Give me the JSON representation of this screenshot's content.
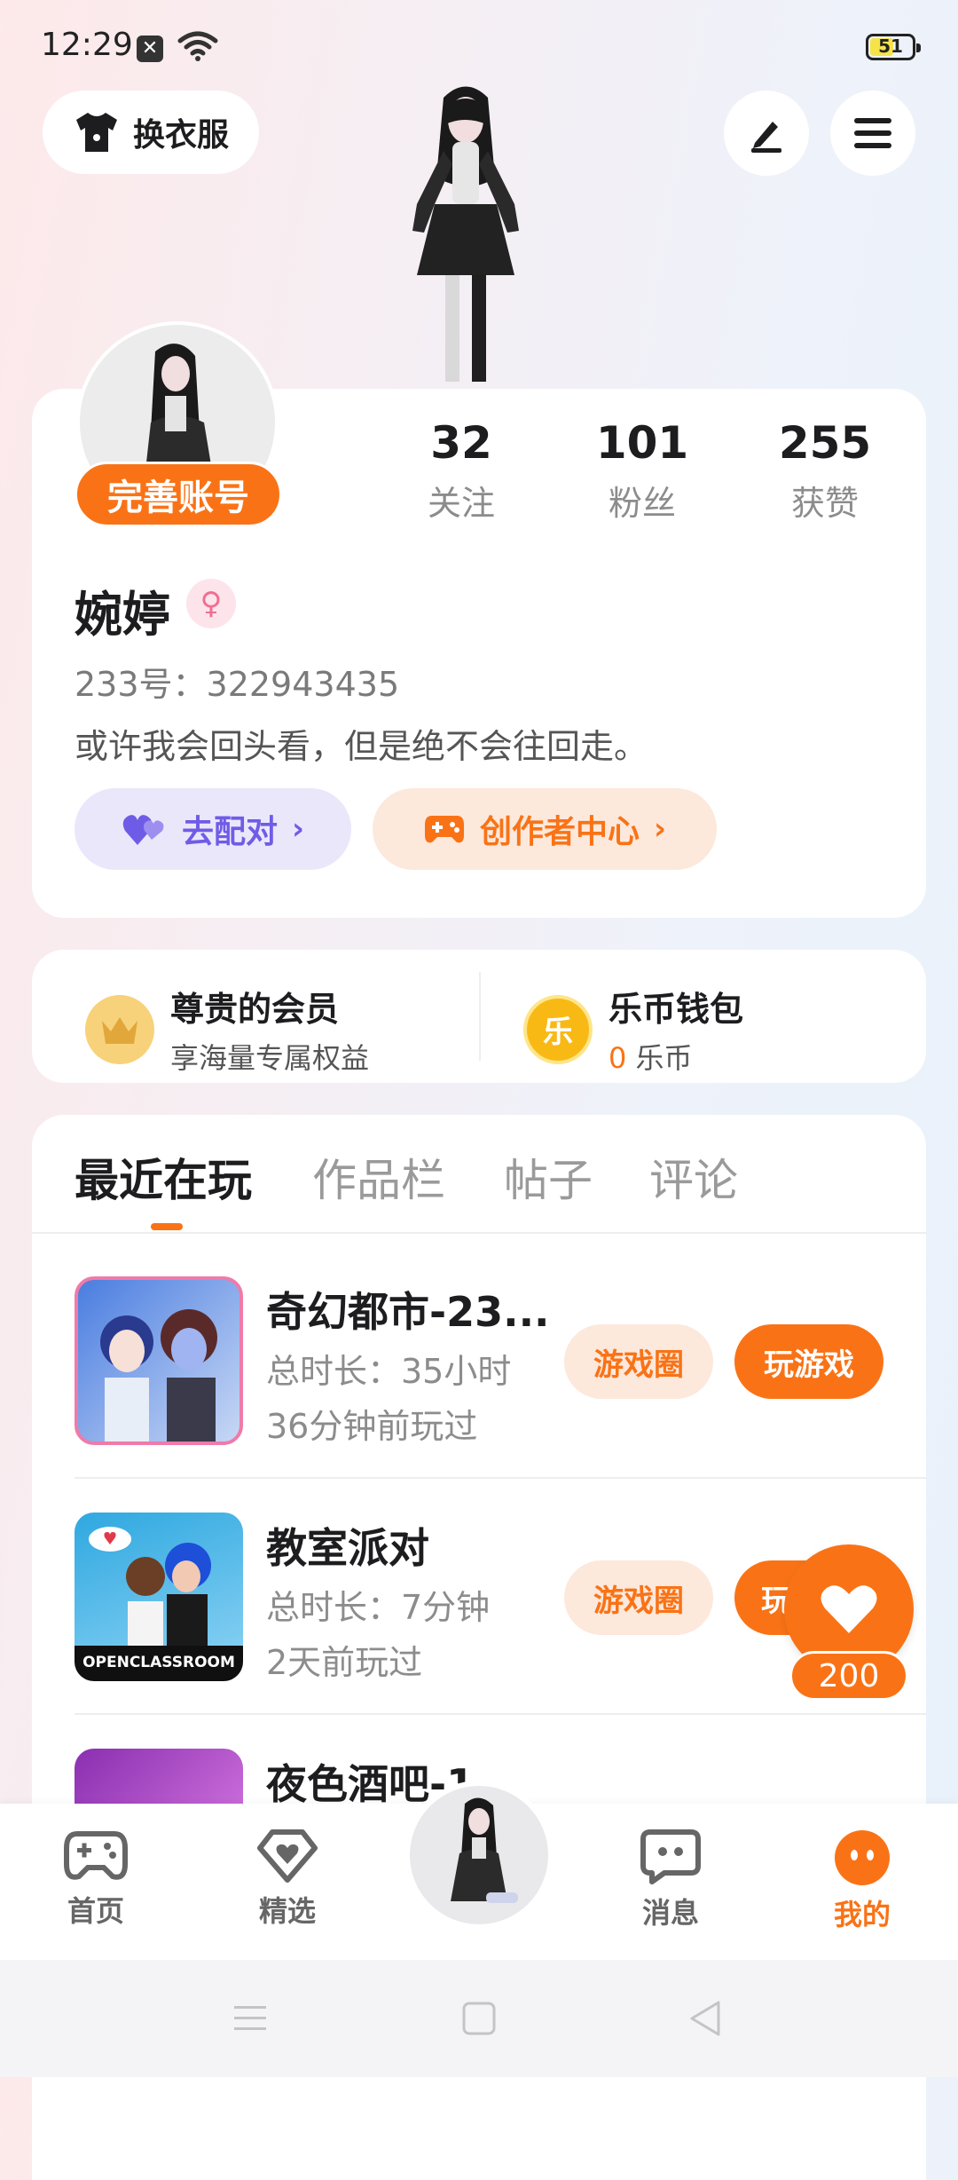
{
  "status_bar": {
    "time": "12:29",
    "battery": "51"
  },
  "top": {
    "outfit_label": "换衣服"
  },
  "profile": {
    "complete_label": "完善账号",
    "stats": [
      {
        "num": "32",
        "label": "关注"
      },
      {
        "num": "101",
        "label": "粉丝"
      },
      {
        "num": "255",
        "label": "获赞"
      }
    ],
    "name": "婉婷",
    "gender_symbol": "♀",
    "uid": "233号：322943435",
    "bio": "或许我会回头看，但是绝不会往回走。",
    "match_label": "去配对",
    "creator_label": "创作者中心"
  },
  "member": {
    "vip_title": "尊贵的会员",
    "vip_sub": "享海量专属权益",
    "wallet_title": "乐币钱包",
    "wallet_amount": "0",
    "wallet_unit": "乐币",
    "coin_char": "乐"
  },
  "tabs": [
    "最近在玩",
    "作品栏",
    "帖子",
    "评论"
  ],
  "games": [
    {
      "title": "奇幻都市-23...",
      "duration": "总时长：35小时",
      "last": "36分钟前玩过",
      "circle": "游戏圈",
      "play": "玩游戏"
    },
    {
      "title": "教室派对",
      "duration": "总时长：7分钟",
      "last": "2天前玩过",
      "circle": "游戏圈",
      "play": "玩",
      "thumb_text": "OPENCLASSROOM"
    },
    {
      "title": "夜色酒吧-1"
    }
  ],
  "float_like": {
    "count": "200"
  },
  "nav": [
    {
      "label": "首页"
    },
    {
      "label": "精选"
    },
    {
      "label": "消息"
    },
    {
      "label": "我的"
    }
  ],
  "colors": {
    "accent": "#f97316",
    "purple": "#6f5ce6"
  }
}
